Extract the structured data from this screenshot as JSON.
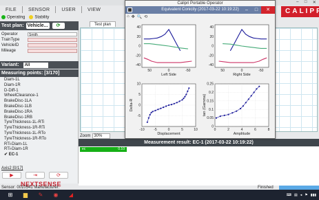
{
  "app": {
    "menu": [
      "FILE",
      "SENSOR",
      "USER",
      "VIEW"
    ],
    "status": [
      {
        "label": "Operating",
        "color": "#18b418"
      },
      {
        "label": "Stability",
        "color": "#f0d020"
      }
    ],
    "brand": "CALIPR",
    "window_controls": [
      "–",
      "□",
      "✕"
    ]
  },
  "left": {
    "test_plan_label": "Test plan:",
    "test_plan_value": "Vehicle...",
    "fields": [
      {
        "label": "Operator",
        "value": "Smith"
      },
      {
        "label": "TrainType",
        "value": ""
      },
      {
        "label": "VehicleID",
        "value": ""
      },
      {
        "label": "Mileage",
        "value": ""
      }
    ],
    "variant_label": "Variant:",
    "variant_value": "All",
    "measuring_points_header": "Measuring points: [3/170]",
    "measuring_points": [
      "Diam-1L",
      "Diam-1R",
      "D-Diff-1",
      "WheelClearance-1",
      "BrakeDisc-1LA",
      "BrakeDisc-1LB",
      "BrakeDisc-1RA",
      "BrakeDisc-1RB",
      "TyreThickness-1L-RTi",
      "TyreThickness-1R-RTi",
      "TyreThickness-1L-RTo",
      "TyreThickness-1R-RTo",
      "RTi-Diam-1L",
      "RTi-Diam-1R"
    ],
    "selected_point": "✔ EC-1",
    "axis_label": "Axis2 [0/17]",
    "logo": "NEXTSENSE",
    "sensor_text": "Sensor: 0010541 Manufacturer:"
  },
  "main": {
    "tab": "Test plan",
    "zoom_label": "Zoom",
    "zoom_value": "30%",
    "result_title": "Measurement result: EC-1 (2017-03-22 10:19:22)",
    "result_strip_left": "ec",
    "result_strip_right": "0.10",
    "finished_label": "Finished",
    "progress": 1.0
  },
  "dialog": {
    "outer_title": "Calipri Portable Operator",
    "title": "Equivalent Conicity (2017-03-22 10:19:22)",
    "toolbar_icons": [
      "⌂",
      "✥",
      "🔍",
      "⟲"
    ]
  },
  "chart_data": [
    {
      "type": "line",
      "title": "",
      "xlabel": "Left Side",
      "ylabel": "",
      "xlim": [
        70,
        -70
      ],
      "ylim": [
        -45,
        45
      ],
      "xticks": [
        50,
        0,
        -50
      ],
      "yticks": [
        40,
        20,
        0,
        -20,
        -40
      ],
      "series": [
        {
          "values": [
            [
              65,
              15
            ],
            [
              50,
              15
            ],
            [
              40,
              16
            ],
            [
              30,
              17
            ],
            [
              20,
              20
            ],
            [
              10,
              25
            ],
            [
              0,
              35
            ],
            [
              -10,
              20
            ],
            [
              -20,
              5
            ],
            [
              -30,
              -10
            ]
          ]
        },
        {
          "values": [
            [
              65,
              5
            ],
            [
              50,
              5
            ],
            [
              40,
              4
            ],
            [
              30,
              3
            ],
            [
              20,
              2
            ],
            [
              10,
              1
            ],
            [
              0,
              0
            ],
            [
              -15,
              -2
            ],
            [
              -30,
              -4
            ],
            [
              -50,
              -6
            ]
          ]
        },
        {
          "values": [
            [
              65,
              -25
            ],
            [
              55,
              -28
            ],
            [
              45,
              -32
            ],
            [
              30,
              -35
            ],
            [
              10,
              -35
            ],
            [
              -10,
              -35
            ],
            [
              -30,
              -35
            ],
            [
              -50,
              -33
            ],
            [
              -60,
              -32
            ]
          ]
        }
      ]
    },
    {
      "type": "line",
      "title": "",
      "xlabel": "Right Side",
      "ylabel": "",
      "xlim": [
        70,
        -70
      ],
      "ylim": [
        -45,
        45
      ],
      "xticks": [
        50,
        0,
        -50
      ],
      "yticks": [
        40,
        20,
        0,
        -20,
        -40
      ],
      "series": [
        {
          "values": [
            [
              30,
              -10
            ],
            [
              20,
              5
            ],
            [
              10,
              20
            ],
            [
              0,
              35
            ],
            [
              -10,
              25
            ],
            [
              -20,
              20
            ],
            [
              -30,
              17
            ],
            [
              -40,
              16
            ],
            [
              -50,
              15
            ],
            [
              -65,
              15
            ]
          ]
        },
        {
          "values": [
            [
              50,
              5
            ],
            [
              30,
              4
            ],
            [
              15,
              2
            ],
            [
              0,
              0
            ],
            [
              -10,
              -1
            ],
            [
              -20,
              -2
            ],
            [
              -30,
              -3
            ],
            [
              -40,
              -4
            ],
            [
              -50,
              -5
            ],
            [
              -65,
              -5
            ]
          ]
        },
        {
          "values": [
            [
              60,
              -32
            ],
            [
              50,
              -33
            ],
            [
              30,
              -35
            ],
            [
              10,
              -35
            ],
            [
              -10,
              -35
            ],
            [
              -30,
              -35
            ],
            [
              -45,
              -32
            ],
            [
              -55,
              -28
            ],
            [
              -65,
              -25
            ]
          ]
        }
      ]
    },
    {
      "type": "scatter",
      "title": "",
      "xlabel": "Displacement",
      "ylabel": "Delta-R",
      "xlim": [
        -10,
        10
      ],
      "ylim": [
        -10,
        10
      ],
      "xticks": [
        -10,
        -5,
        0,
        5,
        10
      ],
      "yticks": [
        10,
        5,
        0,
        -5
      ],
      "series": [
        {
          "values": [
            [
              -8,
              -8
            ],
            [
              -7.5,
              -6
            ],
            [
              -7,
              -4.5
            ],
            [
              -6.5,
              -3.5
            ],
            [
              -6,
              -3
            ],
            [
              -5,
              -2.5
            ],
            [
              -4,
              -2
            ],
            [
              -3,
              -1.5
            ],
            [
              -2,
              -1
            ],
            [
              -1,
              -0.5
            ],
            [
              0,
              0
            ],
            [
              1,
              0.3
            ],
            [
              2,
              0.7
            ],
            [
              3,
              1.2
            ],
            [
              4,
              1.8
            ],
            [
              5,
              2.5
            ],
            [
              5.5,
              3.2
            ],
            [
              6,
              4
            ],
            [
              6.5,
              5
            ],
            [
              7,
              6.5
            ],
            [
              7.5,
              8
            ]
          ]
        }
      ]
    },
    {
      "type": "scatter",
      "title": "",
      "xlabel": "Amplitude",
      "ylabel": "tan (Gamma)",
      "xlim": [
        0,
        8
      ],
      "ylim": [
        0,
        0.25
      ],
      "xticks": [
        0,
        2,
        4,
        6,
        8
      ],
      "yticks": [
        0.25,
        0.2,
        0.15,
        0.1,
        0.05,
        0
      ],
      "series": [
        {
          "values": [
            [
              0.2,
              0.05
            ],
            [
              0.8,
              0.06
            ],
            [
              1.4,
              0.065
            ],
            [
              2,
              0.07
            ],
            [
              2.6,
              0.08
            ],
            [
              3.2,
              0.09
            ],
            [
              3.8,
              0.105
            ],
            [
              4.2,
              0.12
            ],
            [
              4.6,
              0.14
            ],
            [
              5,
              0.16
            ],
            [
              5.4,
              0.18
            ],
            [
              5.8,
              0.2
            ],
            [
              6.2,
              0.22
            ],
            [
              6.6,
              0.235
            ]
          ]
        }
      ]
    }
  ]
}
